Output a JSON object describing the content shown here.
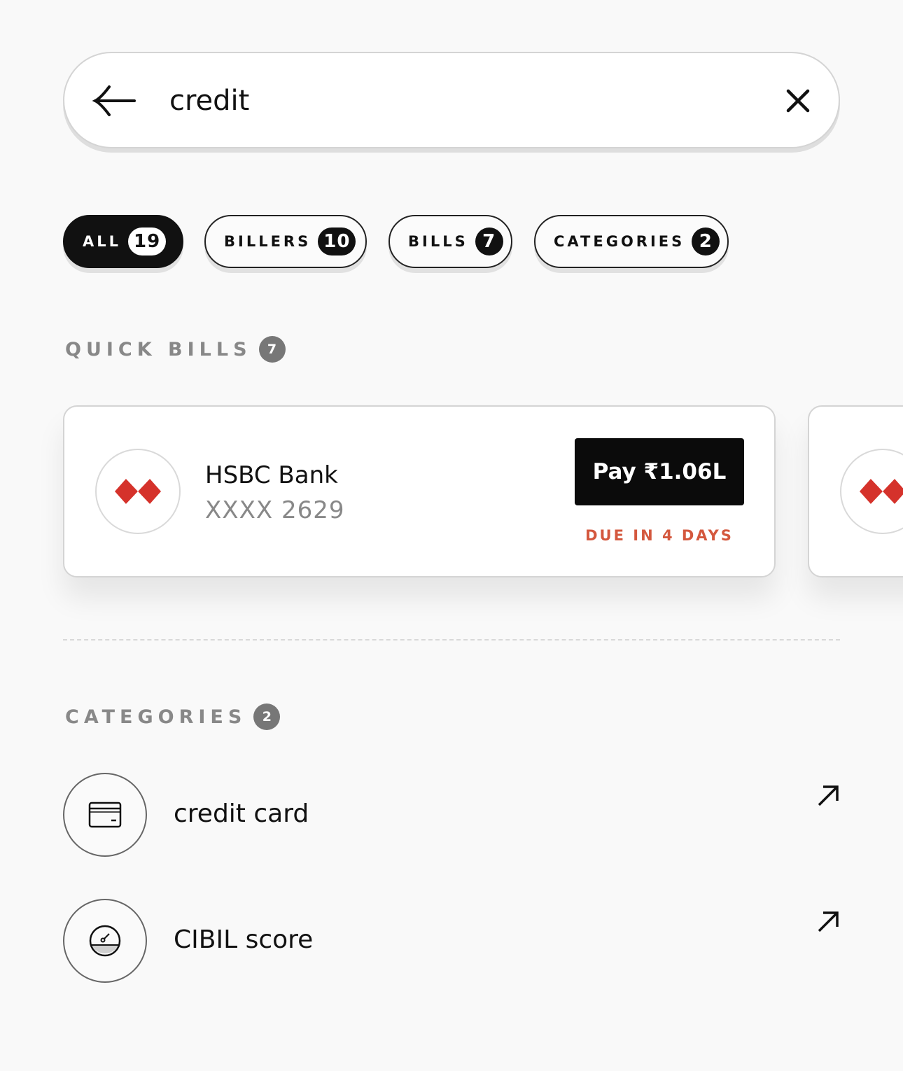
{
  "search": {
    "value": "credit",
    "back_icon": "arrow-left-icon",
    "clear_icon": "close-icon"
  },
  "filters": [
    {
      "label": "ALL",
      "count": "19",
      "active": true
    },
    {
      "label": "BILLERS",
      "count": "10",
      "active": false
    },
    {
      "label": "BILLS",
      "count": "7",
      "active": false
    },
    {
      "label": "CATEGORIES",
      "count": "2",
      "active": false
    }
  ],
  "quick_bills": {
    "title": "QUICK BILLS",
    "count": "7",
    "cards": [
      {
        "bank": "HSBC Bank",
        "account": "XXXX 2629",
        "pay_label": "Pay ₹1.06L",
        "due": "DUE IN 4 DAYS",
        "logo": "hsbc-logo-icon"
      }
    ]
  },
  "categories": {
    "title": "CATEGORIES",
    "count": "2",
    "items": [
      {
        "label": "credit card",
        "icon": "credit-card-icon"
      },
      {
        "label": "CIBIL score",
        "icon": "gauge-icon"
      }
    ]
  },
  "colors": {
    "background": "#f9f9f9",
    "accent_dark": "#0b0b0b",
    "due_red": "#d4583e",
    "hsbc_red": "#d5322b",
    "muted_text": "#888888"
  }
}
